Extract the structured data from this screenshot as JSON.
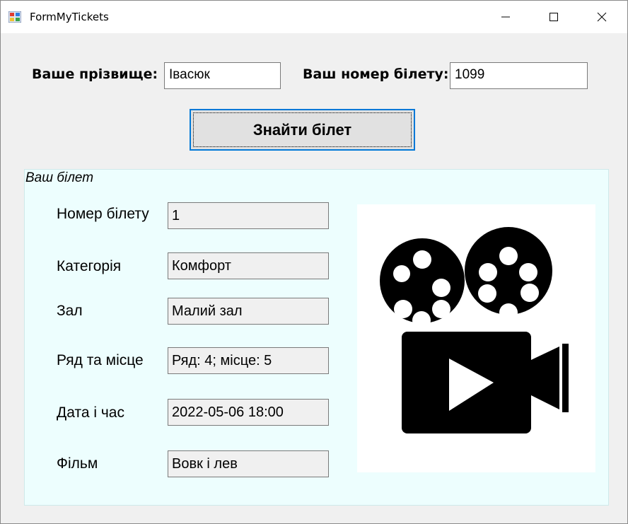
{
  "window": {
    "title": "FormMyTickets"
  },
  "search": {
    "surname_label": "Ваше прізвище:",
    "surname_value": "Івасюк",
    "ticket_label": "Ваш номер білету:",
    "ticket_value": "1099",
    "find_button": "Знайти білет"
  },
  "ticket": {
    "group_title": "Ваш білет",
    "fields": [
      {
        "label": "Номер білету",
        "value": "1"
      },
      {
        "label": "Категорія",
        "value": "Комфорт"
      },
      {
        "label": "Зал",
        "value": "Малий зал"
      },
      {
        "label": "Ряд та місце",
        "value": "Ряд: 4; місце: 5"
      },
      {
        "label": "Дата і час",
        "value": "2022-05-06 18:00"
      },
      {
        "label": "Фільм",
        "value": "Вовк і лев"
      }
    ],
    "picture_icon": "movie-camera-icon"
  },
  "colors": {
    "group_background": "#edfefe",
    "focus_border": "#0078d7"
  }
}
